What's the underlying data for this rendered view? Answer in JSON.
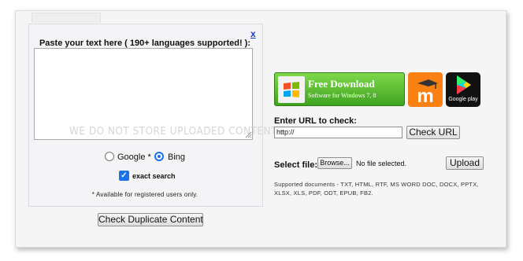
{
  "left": {
    "close_label": "x",
    "paste_label": "Paste your text here ( 190+ languages supported! ):",
    "textarea_value": "",
    "watermark": "WE DO NOT STORE UPLOADED CONTENT",
    "engines": {
      "google_label": "Google *",
      "bing_label": "Bing",
      "selected": "Bing"
    },
    "exact_search": {
      "label": "exact search",
      "checked": true
    },
    "note": "* Available for registered users only.",
    "check_button": "Check Duplicate Content"
  },
  "right": {
    "banner": {
      "title": "Free Download",
      "subtitle": "Software for Windows 7, 8"
    },
    "apps": {
      "moodle_icon": "moodle-icon",
      "google_play_label": "Google play"
    },
    "url": {
      "label": "Enter URL to check:",
      "value": "http://",
      "button": "Check URL"
    },
    "file": {
      "label": "Select file:",
      "browse_button": "Browse...",
      "status": "No file selected.",
      "upload_button": "Upload"
    },
    "supported_docs": "Supported documents - TXT, HTML, RTF, MS WORD DOC, DOCX, PPTX, XLSX, XLS, PDF, ODT, EPUB, FB2."
  },
  "colors": {
    "accent": "#1a73e8",
    "banner_green": "#4caf2a",
    "moodle_orange": "#f98012",
    "panel_bg": "#f4f4f6"
  }
}
